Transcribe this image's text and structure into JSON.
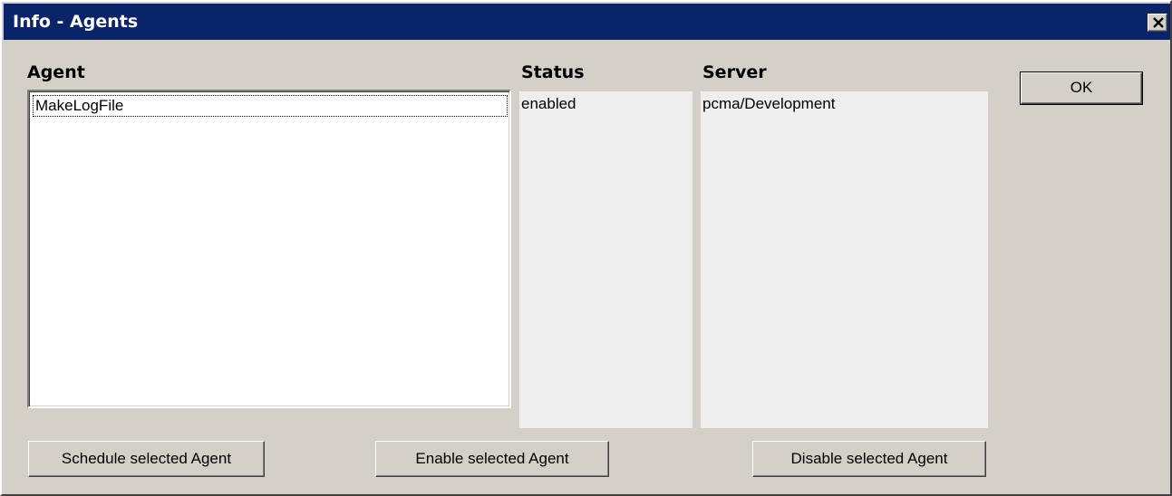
{
  "window": {
    "title": "Info - Agents"
  },
  "headings": {
    "agent": "Agent",
    "status": "Status",
    "server": "Server"
  },
  "agents": [
    {
      "name": "MakeLogFile",
      "status": "enabled",
      "server": "pcma/Development"
    }
  ],
  "buttons": {
    "ok": "OK",
    "schedule": "Schedule selected Agent",
    "enable": "Enable selected Agent",
    "disable": "Disable selected Agent"
  },
  "icons": {
    "close": "close-icon"
  }
}
